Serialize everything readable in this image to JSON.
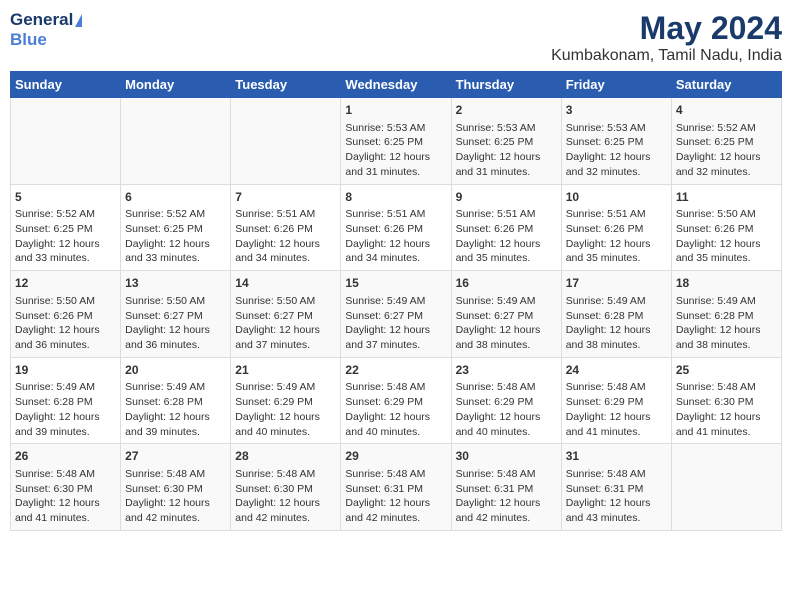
{
  "header": {
    "logo_general": "General",
    "logo_blue": "Blue",
    "title": "May 2024",
    "subtitle": "Kumbakonam, Tamil Nadu, India"
  },
  "days_of_week": [
    "Sunday",
    "Monday",
    "Tuesday",
    "Wednesday",
    "Thursday",
    "Friday",
    "Saturday"
  ],
  "weeks": [
    [
      {
        "day": "",
        "sunrise": "",
        "sunset": "",
        "daylight": ""
      },
      {
        "day": "",
        "sunrise": "",
        "sunset": "",
        "daylight": ""
      },
      {
        "day": "",
        "sunrise": "",
        "sunset": "",
        "daylight": ""
      },
      {
        "day": "1",
        "sunrise": "Sunrise: 5:53 AM",
        "sunset": "Sunset: 6:25 PM",
        "daylight": "Daylight: 12 hours and 31 minutes."
      },
      {
        "day": "2",
        "sunrise": "Sunrise: 5:53 AM",
        "sunset": "Sunset: 6:25 PM",
        "daylight": "Daylight: 12 hours and 31 minutes."
      },
      {
        "day": "3",
        "sunrise": "Sunrise: 5:53 AM",
        "sunset": "Sunset: 6:25 PM",
        "daylight": "Daylight: 12 hours and 32 minutes."
      },
      {
        "day": "4",
        "sunrise": "Sunrise: 5:52 AM",
        "sunset": "Sunset: 6:25 PM",
        "daylight": "Daylight: 12 hours and 32 minutes."
      }
    ],
    [
      {
        "day": "5",
        "sunrise": "Sunrise: 5:52 AM",
        "sunset": "Sunset: 6:25 PM",
        "daylight": "Daylight: 12 hours and 33 minutes."
      },
      {
        "day": "6",
        "sunrise": "Sunrise: 5:52 AM",
        "sunset": "Sunset: 6:25 PM",
        "daylight": "Daylight: 12 hours and 33 minutes."
      },
      {
        "day": "7",
        "sunrise": "Sunrise: 5:51 AM",
        "sunset": "Sunset: 6:26 PM",
        "daylight": "Daylight: 12 hours and 34 minutes."
      },
      {
        "day": "8",
        "sunrise": "Sunrise: 5:51 AM",
        "sunset": "Sunset: 6:26 PM",
        "daylight": "Daylight: 12 hours and 34 minutes."
      },
      {
        "day": "9",
        "sunrise": "Sunrise: 5:51 AM",
        "sunset": "Sunset: 6:26 PM",
        "daylight": "Daylight: 12 hours and 35 minutes."
      },
      {
        "day": "10",
        "sunrise": "Sunrise: 5:51 AM",
        "sunset": "Sunset: 6:26 PM",
        "daylight": "Daylight: 12 hours and 35 minutes."
      },
      {
        "day": "11",
        "sunrise": "Sunrise: 5:50 AM",
        "sunset": "Sunset: 6:26 PM",
        "daylight": "Daylight: 12 hours and 35 minutes."
      }
    ],
    [
      {
        "day": "12",
        "sunrise": "Sunrise: 5:50 AM",
        "sunset": "Sunset: 6:26 PM",
        "daylight": "Daylight: 12 hours and 36 minutes."
      },
      {
        "day": "13",
        "sunrise": "Sunrise: 5:50 AM",
        "sunset": "Sunset: 6:27 PM",
        "daylight": "Daylight: 12 hours and 36 minutes."
      },
      {
        "day": "14",
        "sunrise": "Sunrise: 5:50 AM",
        "sunset": "Sunset: 6:27 PM",
        "daylight": "Daylight: 12 hours and 37 minutes."
      },
      {
        "day": "15",
        "sunrise": "Sunrise: 5:49 AM",
        "sunset": "Sunset: 6:27 PM",
        "daylight": "Daylight: 12 hours and 37 minutes."
      },
      {
        "day": "16",
        "sunrise": "Sunrise: 5:49 AM",
        "sunset": "Sunset: 6:27 PM",
        "daylight": "Daylight: 12 hours and 38 minutes."
      },
      {
        "day": "17",
        "sunrise": "Sunrise: 5:49 AM",
        "sunset": "Sunset: 6:28 PM",
        "daylight": "Daylight: 12 hours and 38 minutes."
      },
      {
        "day": "18",
        "sunrise": "Sunrise: 5:49 AM",
        "sunset": "Sunset: 6:28 PM",
        "daylight": "Daylight: 12 hours and 38 minutes."
      }
    ],
    [
      {
        "day": "19",
        "sunrise": "Sunrise: 5:49 AM",
        "sunset": "Sunset: 6:28 PM",
        "daylight": "Daylight: 12 hours and 39 minutes."
      },
      {
        "day": "20",
        "sunrise": "Sunrise: 5:49 AM",
        "sunset": "Sunset: 6:28 PM",
        "daylight": "Daylight: 12 hours and 39 minutes."
      },
      {
        "day": "21",
        "sunrise": "Sunrise: 5:49 AM",
        "sunset": "Sunset: 6:29 PM",
        "daylight": "Daylight: 12 hours and 40 minutes."
      },
      {
        "day": "22",
        "sunrise": "Sunrise: 5:48 AM",
        "sunset": "Sunset: 6:29 PM",
        "daylight": "Daylight: 12 hours and 40 minutes."
      },
      {
        "day": "23",
        "sunrise": "Sunrise: 5:48 AM",
        "sunset": "Sunset: 6:29 PM",
        "daylight": "Daylight: 12 hours and 40 minutes."
      },
      {
        "day": "24",
        "sunrise": "Sunrise: 5:48 AM",
        "sunset": "Sunset: 6:29 PM",
        "daylight": "Daylight: 12 hours and 41 minutes."
      },
      {
        "day": "25",
        "sunrise": "Sunrise: 5:48 AM",
        "sunset": "Sunset: 6:30 PM",
        "daylight": "Daylight: 12 hours and 41 minutes."
      }
    ],
    [
      {
        "day": "26",
        "sunrise": "Sunrise: 5:48 AM",
        "sunset": "Sunset: 6:30 PM",
        "daylight": "Daylight: 12 hours and 41 minutes."
      },
      {
        "day": "27",
        "sunrise": "Sunrise: 5:48 AM",
        "sunset": "Sunset: 6:30 PM",
        "daylight": "Daylight: 12 hours and 42 minutes."
      },
      {
        "day": "28",
        "sunrise": "Sunrise: 5:48 AM",
        "sunset": "Sunset: 6:30 PM",
        "daylight": "Daylight: 12 hours and 42 minutes."
      },
      {
        "day": "29",
        "sunrise": "Sunrise: 5:48 AM",
        "sunset": "Sunset: 6:31 PM",
        "daylight": "Daylight: 12 hours and 42 minutes."
      },
      {
        "day": "30",
        "sunrise": "Sunrise: 5:48 AM",
        "sunset": "Sunset: 6:31 PM",
        "daylight": "Daylight: 12 hours and 42 minutes."
      },
      {
        "day": "31",
        "sunrise": "Sunrise: 5:48 AM",
        "sunset": "Sunset: 6:31 PM",
        "daylight": "Daylight: 12 hours and 43 minutes."
      },
      {
        "day": "",
        "sunrise": "",
        "sunset": "",
        "daylight": ""
      }
    ]
  ]
}
